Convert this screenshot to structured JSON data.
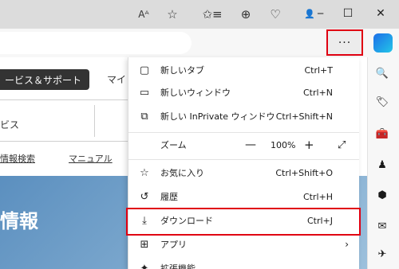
{
  "window": {
    "minimize_icon": "—",
    "maximize_icon": "☐",
    "close_icon": "✕"
  },
  "toolbar": {
    "read_aloud_icon": "Aᴬ",
    "favorite_icon": "☆",
    "favorites_list_icon": "✩≡",
    "collections_icon": "⊕",
    "health_icon": "♡",
    "profile_icon": "👤",
    "more_icon": "···"
  },
  "web": {
    "support_button": "ービス＆サポート",
    "mai": "マイ",
    "service": "ビス",
    "link_info": "情報検索",
    "link_manual": "マニュアル",
    "hero_text": "情報"
  },
  "menu": {
    "items": [
      {
        "label": "新しいタブ",
        "shortcut": "Ctrl+T",
        "icon": "▢"
      },
      {
        "label": "新しいウィンドウ",
        "shortcut": "Ctrl+N",
        "icon": "▭"
      },
      {
        "label": "新しい InPrivate ウィンドウ",
        "shortcut": "Ctrl+Shift+N",
        "icon": "⧉"
      },
      {
        "label": "ズーム",
        "icon": ""
      },
      {
        "label": "お気に入り",
        "shortcut": "Ctrl+Shift+O",
        "icon": "☆"
      },
      {
        "label": "履歴",
        "shortcut": "Ctrl+H",
        "icon": "↺"
      },
      {
        "label": "ダウンロード",
        "shortcut": "Ctrl+J",
        "icon": "⤓"
      },
      {
        "label": "アプリ",
        "icon": "⊞",
        "arrow": "›"
      },
      {
        "label": "拡張機能",
        "icon": "✦"
      }
    ],
    "zoom": {
      "minus": "—",
      "value": "100%",
      "plus": "+",
      "fullscreen": "⤢"
    }
  },
  "sidebar": {
    "icons": [
      "🔍",
      "🏷",
      "🧰",
      "♟",
      "⬢",
      "✉",
      "✈"
    ]
  },
  "colors": {
    "highlight": "#e00012",
    "copilot": "#1c6ee8"
  }
}
